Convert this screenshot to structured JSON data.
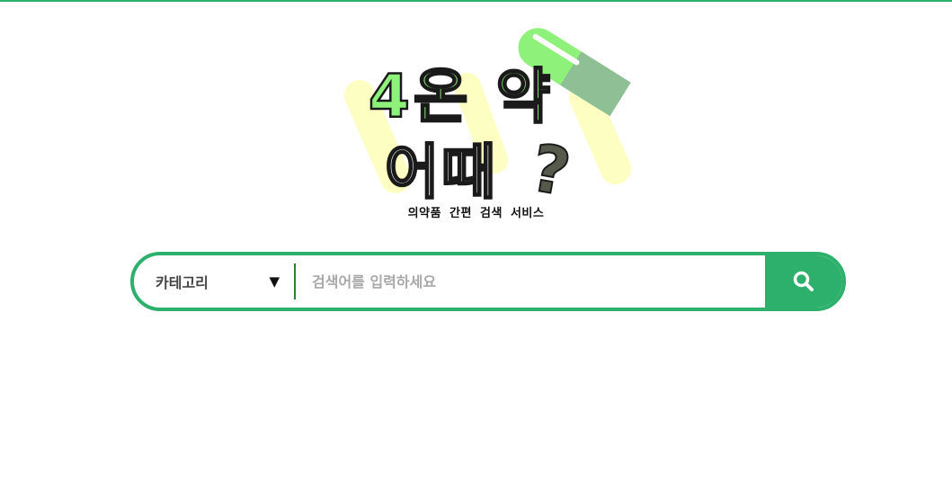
{
  "logo": {
    "line1": "4온 약",
    "line2": "어때",
    "mark": "?",
    "subtitle": "의약품 간편 검색 서비스"
  },
  "search": {
    "category_label": "카테고리",
    "caret_icon": "▼",
    "placeholder": "검색어를 입력하세요",
    "value": ""
  },
  "colors": {
    "brand_green": "#2db06b",
    "logo_light_green": "#8ef27a",
    "logo_yellow": "#fdffc2",
    "pill_gray_green": "#8fbf95",
    "dark_mark": "#555a4b"
  }
}
